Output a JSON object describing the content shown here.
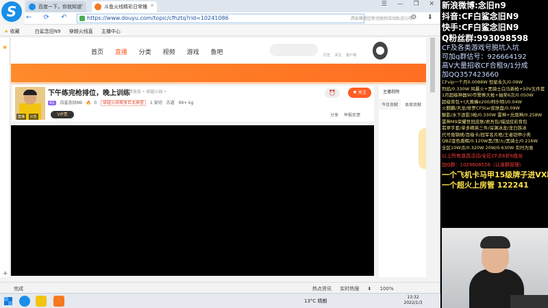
{
  "browser": {
    "logo": "S",
    "tabs": [
      {
        "label": "百度一下，你就知道",
        "close": "×"
      },
      {
        "label": "斗鱼火线精彩日常播",
        "close": "×"
      }
    ],
    "window_controls": "☰ — ❐ ✕",
    "nav_icons": "← ⟳ ↶ ⌂",
    "url": "https://www.douyu.com/topic/cfhztq?rid=10241086",
    "url_hint": "西安雁塔区新冠病例活动轨迹公布",
    "nav_right": "⚙ ⬇",
    "bookmarks": [
      "收藏",
      "白鲨念旧N9",
      "穿越火线直",
      "主播中心"
    ]
  },
  "page": {
    "menu": [
      "首页",
      "直播",
      "分类",
      "视频",
      "游戏",
      "鱼吧"
    ],
    "header_links": [
      "历史",
      "关注",
      "客户端"
    ],
    "room": {
      "title": "下午练完枪排位，晚上训练",
      "category": "网游竞技 • 穿越火线 •",
      "level": "41",
      "anchor": "白鲨念旧N9",
      "heat": "0",
      "tag": "穿越火线尊享巨太高誉",
      "rank": "1 安切",
      "stat1": "古道",
      "stat2": "99+  kg",
      "avatar_tags": [
        "直播",
        "公告"
      ],
      "vip": "VIP贵",
      "alarm_icon": "⏰",
      "follow": "♥ 关注",
      "share": "分享",
      "report": "举报反馈"
    },
    "right_panel": {
      "title": "主播视频",
      "tabs": [
        "今日贡献",
        "本周贡献"
      ]
    }
  },
  "status_bar": {
    "left": "完成",
    "right": [
      "热点资讯",
      "实时热搜",
      "⬇",
      "100%"
    ]
  },
  "taskbar": {
    "weather": "13°C 晴朗",
    "time": "13:32",
    "date": "2022/1/3"
  },
  "overlay": {
    "lines_big": [
      "新浪微博:念旧n9",
      "抖音:CF白鲨念旧N9",
      "快手:CF白鲨念旧N9",
      "Q粉丝群:993098598"
    ],
    "lines_mid": [
      "CF及各类游戏号脱坑入坑",
      "可加q群估号：926664192",
      "高V大量招收CF合租9/1分成",
      "加QQ357423660"
    ],
    "lines_small": [
      "CFvip一个月0.0088W  恒星永久/0.09W",
      "烈焰/0.330W 风暴火+黑骑士白马新枪+50V五件套",
      "1月超级神器90币警察大枪+抽奖6次/0.050W",
      "超级背包+(大黄蜂x200/柯尔特)/0.04W",
      "火麒麟/天龙/修罗CFStar皮肤盘/0.09W",
      "魅影/水下逐影3枪/0.330W 雷神+光炮神/0.258W",
      "雷神M9荣耀世冠皮肤/君吾包/城战炫彩背包",
      "翡翠手套/单多精英三件/深渊冰龙/龙日族冰",
      "代号角锦绣/百级卡/冠军名片框/王者铠甲小秀",
      "QBZ金色盾辉/0.120W黑/顶/火/黑骑士/0.216W",
      "全区10W点/0.320W 20W/0.630W 实时为准"
    ],
    "lines_red": [
      "以上所有道具活动/全区CF点6折6盘龙",
      "加Q群：1029608556（认准群管理）"
    ],
    "lines_ylw": [
      "一个飞机卡马甲15级牌子进VX群",
      "一个超火上房管 122241"
    ]
  }
}
